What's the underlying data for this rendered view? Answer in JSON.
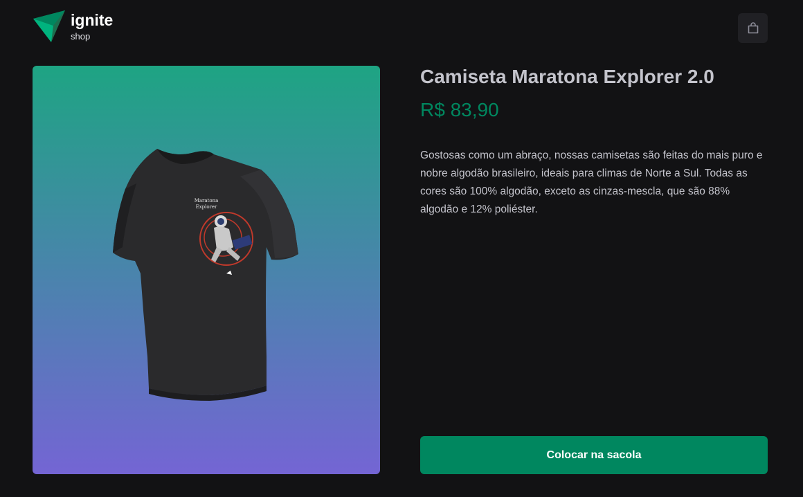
{
  "header": {
    "logo": {
      "name": "ignite",
      "subtitle": "shop",
      "icon": "ignite-triangle-logo"
    },
    "cart_icon": "shopping-bag-icon"
  },
  "product": {
    "title": "Camiseta Maratona Explorer 2.0",
    "price": "R$ 83,90",
    "description": "Gostosas como um abraço, nossas camisetas são feitas do mais puro e nobre algodão brasileiro, ideais para climas de Norte a Sul. Todas as cores são 100% algodão, exceto as cinzas-mescla, que são 88% algodão e 12% poliéster.",
    "image": {
      "shirt_print_line1": "Maratona",
      "shirt_print_line2": "Explorer",
      "gradient": [
        "#1ea483",
        "#7465d4"
      ]
    },
    "buy_label": "Colocar na sacola"
  },
  "colors": {
    "background": "#121214",
    "accent": "#00875f",
    "text": "#c4c4cc",
    "button_bg": "#202024"
  }
}
